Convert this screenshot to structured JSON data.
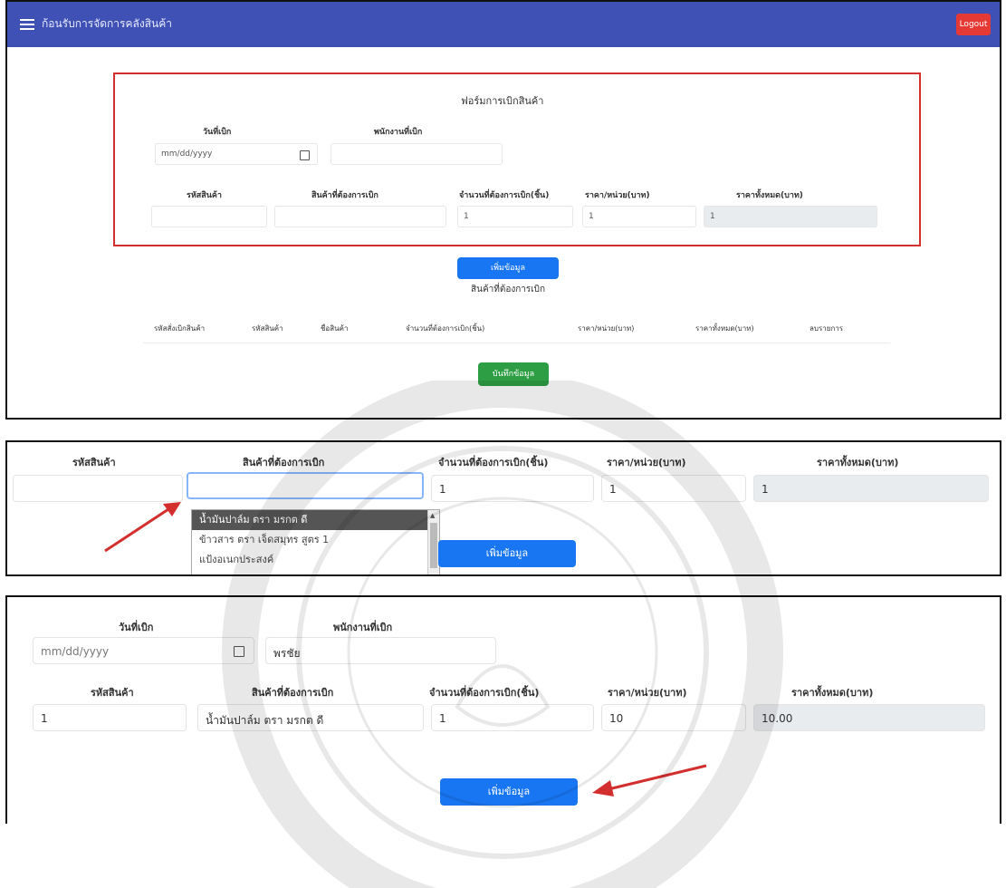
{
  "panel1": {
    "app_title": "ก้อนรับการจัดการคลังสินค้า",
    "logout_label": "Logout",
    "form_title": "ฟอร์มการเบิกสินค้า",
    "date_label": "วันที่เบิก",
    "date_placeholder": "mm/dd/yyyy",
    "employee_label": "พนักงานที่เบิก",
    "col_code": "รหัสสินค้า",
    "col_product": "สินค้าที่ต้องการเบิก",
    "col_qty": "จำนวนที่ต้องการเบิก(ชิ้น)",
    "col_unit_price": "ราคา/หน่วย(บาท)",
    "col_total": "ราคาทั้งหมด(บาท)",
    "qty_value": "1",
    "unit_price_value": "1",
    "total_value": "1",
    "add_button": "เพิ่มข้อมูล",
    "list_title": "สินค้าที่ต้องการเบิก",
    "table_headers": [
      "รหัสสั่งเบิกสินค้า",
      "รหัสสินค้า",
      "ชื่อสินค้า",
      "จำนวนที่ต้องการเบิก(ชิ้น)",
      "ราคา/หน่วย(บาท)",
      "ราคาทั้งหมด(บาท)",
      "ลบรายการ"
    ],
    "save_button": "บันทึกข้อมูล"
  },
  "panel2": {
    "col_code": "รหัสสินค้า",
    "col_product": "สินค้าที่ต้องการเบิก",
    "col_qty": "จำนวนที่ต้องการเบิก(ชิ้น)",
    "col_unit_price": "ราคา/หน่วย(บาท)",
    "col_total": "ราคาทั้งหมด(บาท)",
    "qty_value": "1",
    "unit_price_value": "1",
    "total_value": "1",
    "options": [
      "น้ำมันปาล์ม ตรา มรกต ดี",
      "ข้าวสาร ตรา เจ็ดสมุทร สูตร 1",
      "แป้งอเนกประสงค์"
    ],
    "add_button": "เพิ่มข้อมูล"
  },
  "panel3": {
    "date_label": "วันที่เบิก",
    "date_placeholder": "mm/dd/yyyy",
    "employee_label": "พนักงานที่เบิก",
    "employee_value": "พรชัย",
    "col_code": "รหัสสินค้า",
    "col_product": "สินค้าที่ต้องการเบิก",
    "col_qty": "จำนวนที่ต้องการเบิก(ชิ้น)",
    "col_unit_price": "ราคา/หน่วย(บาท)",
    "col_total": "ราคาทั้งหมด(บาท)",
    "code_value": "1",
    "product_value": "น้ำมันปาล์ม ตรา มรกต ดี",
    "qty_value": "1",
    "unit_price_value": "10",
    "total_value": "10.00",
    "add_button": "เพิ่มข้อมูล"
  },
  "colors": {
    "appbar": "#3f51b5",
    "logout": "#e53935",
    "primary": "#1976f2",
    "success": "#2e9e44",
    "highlight_box": "#d32f2f",
    "arrow": "#d32f2f"
  }
}
